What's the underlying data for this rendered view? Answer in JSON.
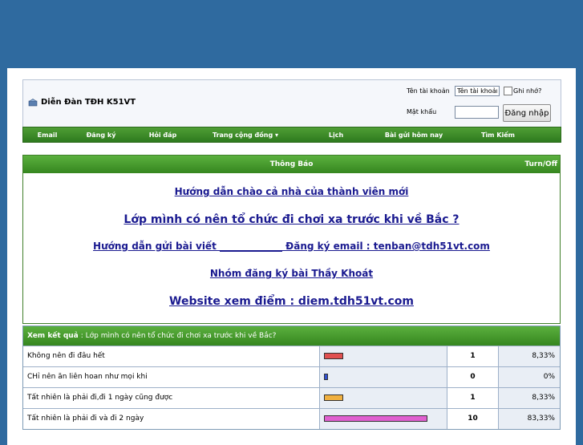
{
  "header": {
    "forum_title": "Diễn Đàn TĐH K51VT",
    "username_label": "Tên tài khoản",
    "username_value": "Tên tài khoản",
    "remember_label": "Ghi nhớ?",
    "password_label": "Mật khẩu",
    "login_button": "Đăng nhập"
  },
  "nav": {
    "items": [
      "Email",
      "Đăng ký",
      "Hỏi đáp",
      "Trang cộng đồng ▾",
      "Lịch",
      "Bài gửi hôm nay",
      "Tìm Kiếm"
    ]
  },
  "notice": {
    "title": "Thông Báo",
    "toggle": "Turn/Off",
    "links": [
      "Hướng dẫn chào cả nhà của thành viên mới",
      "Lớp mình có nên tổ chức đi chơi xa trước khi về Bắc ?",
      "Hướng dẫn gửi bài viết _____________ Đăng ký email : tenban@tdh51vt.com",
      "Nhóm đăng ký bài Thầy Khoát",
      "Website xem điểm : diem.tdh51vt.com"
    ]
  },
  "poll": {
    "head_label": "Xem kết quả",
    "question": ": Lớp mình có nên tổ chức đi chơi xa trước khi về Bắc?",
    "options": [
      {
        "text": "Không nên đi đâu hết",
        "votes": "1",
        "percent": "8,33%",
        "fraction": 0.0833,
        "color": "#e05050"
      },
      {
        "text": "CHỉ nên ăn liên hoan như mọi khi",
        "votes": "0",
        "percent": "0%",
        "fraction": 0.0,
        "color": "#3050d0"
      },
      {
        "text": "Tất nhiên là phải đi,đi 1 ngày cũng được",
        "votes": "1",
        "percent": "8,33%",
        "fraction": 0.0833,
        "color": "#f0b040"
      },
      {
        "text": "Tất nhiên là phải đi và đi 2 ngày",
        "votes": "10",
        "percent": "83,33%",
        "fraction": 0.8333,
        "color": "#e060d0"
      }
    ]
  }
}
